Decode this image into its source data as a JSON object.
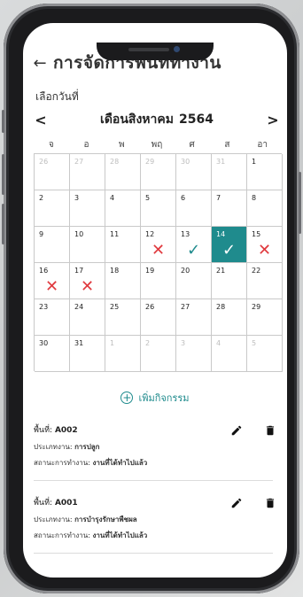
{
  "header": {
    "back_icon": "arrow-left-icon",
    "title": "การจัดการพื้นที่ทำงาน"
  },
  "select_date_label": "เลือกวันที่",
  "calendar": {
    "month": "เดือนสิงหาคม",
    "year": "2564",
    "weekdays": [
      "จ",
      "อ",
      "พ",
      "พฤ",
      "ศ",
      "ส",
      "อา"
    ],
    "days": [
      {
        "n": "26",
        "muted": true,
        "mark": ""
      },
      {
        "n": "27",
        "muted": true,
        "mark": ""
      },
      {
        "n": "28",
        "muted": true,
        "mark": ""
      },
      {
        "n": "29",
        "muted": true,
        "mark": ""
      },
      {
        "n": "30",
        "muted": true,
        "mark": ""
      },
      {
        "n": "31",
        "muted": true,
        "mark": ""
      },
      {
        "n": "1",
        "muted": false,
        "mark": ""
      },
      {
        "n": "2",
        "muted": false,
        "mark": ""
      },
      {
        "n": "3",
        "muted": false,
        "mark": ""
      },
      {
        "n": "4",
        "muted": false,
        "mark": ""
      },
      {
        "n": "5",
        "muted": false,
        "mark": ""
      },
      {
        "n": "6",
        "muted": false,
        "mark": ""
      },
      {
        "n": "7",
        "muted": false,
        "mark": ""
      },
      {
        "n": "8",
        "muted": false,
        "mark": ""
      },
      {
        "n": "9",
        "muted": false,
        "mark": ""
      },
      {
        "n": "10",
        "muted": false,
        "mark": ""
      },
      {
        "n": "11",
        "muted": false,
        "mark": ""
      },
      {
        "n": "12",
        "muted": false,
        "mark": "x"
      },
      {
        "n": "13",
        "muted": false,
        "mark": "check"
      },
      {
        "n": "14",
        "muted": false,
        "mark": "check",
        "selected": true
      },
      {
        "n": "15",
        "muted": false,
        "mark": "x"
      },
      {
        "n": "16",
        "muted": false,
        "mark": "x"
      },
      {
        "n": "17",
        "muted": false,
        "mark": "x"
      },
      {
        "n": "18",
        "muted": false,
        "mark": ""
      },
      {
        "n": "19",
        "muted": false,
        "mark": ""
      },
      {
        "n": "20",
        "muted": false,
        "mark": ""
      },
      {
        "n": "21",
        "muted": false,
        "mark": ""
      },
      {
        "n": "22",
        "muted": false,
        "mark": ""
      },
      {
        "n": "23",
        "muted": false,
        "mark": ""
      },
      {
        "n": "24",
        "muted": false,
        "mark": ""
      },
      {
        "n": "25",
        "muted": false,
        "mark": ""
      },
      {
        "n": "26",
        "muted": false,
        "mark": ""
      },
      {
        "n": "27",
        "muted": false,
        "mark": ""
      },
      {
        "n": "28",
        "muted": false,
        "mark": ""
      },
      {
        "n": "29",
        "muted": false,
        "mark": ""
      },
      {
        "n": "30",
        "muted": false,
        "mark": ""
      },
      {
        "n": "31",
        "muted": false,
        "mark": ""
      },
      {
        "n": "1",
        "muted": true,
        "mark": ""
      },
      {
        "n": "2",
        "muted": true,
        "mark": ""
      },
      {
        "n": "3",
        "muted": true,
        "mark": ""
      },
      {
        "n": "4",
        "muted": true,
        "mark": ""
      },
      {
        "n": "5",
        "muted": true,
        "mark": ""
      }
    ]
  },
  "add_activity_label": "เพิ่มกิจกรรม",
  "activities": [
    {
      "area_label": "พื้นที่:",
      "area_code": "A002",
      "type_label": "ประเภทงาน:",
      "type_value": "การปลูก",
      "status_label": "สถานะการทำงาน:",
      "status_value": "งานที่ได้ทำไปแล้ว"
    },
    {
      "area_label": "พื้นที่:",
      "area_code": "A001",
      "type_label": "ประเภทงาน:",
      "type_value": "การบำรุงรักษาพืชผล",
      "status_label": "สถานะการทำงาน:",
      "status_value": "งานที่ได้ทำไปแล้ว"
    }
  ],
  "colors": {
    "accent": "#1f8b8d",
    "error": "#e0393e"
  }
}
